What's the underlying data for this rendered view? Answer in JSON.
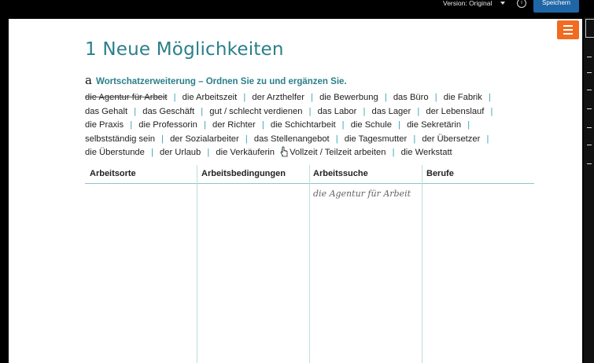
{
  "topbar": {
    "version_label": "Version: Original",
    "info_icon": "info-icon",
    "save_label": "Speichern"
  },
  "toc_icon": "list-icon",
  "exercise": {
    "number": "1",
    "title": "Neue Möglichkeiten",
    "part_letter": "a",
    "instruction": "Wortschatzerweiterung – Ordnen Sie zu und ergänzen Sie.",
    "words": [
      {
        "text": "die Agentur für Arbeit",
        "struck": true
      },
      {
        "text": "die Arbeitszeit"
      },
      {
        "text": "der Arzthelfer"
      },
      {
        "text": "die Bewerbung"
      },
      {
        "text": "das Büro"
      },
      {
        "text": "die Fabrik"
      },
      {
        "text": "das Gehalt"
      },
      {
        "text": "das Geschäft"
      },
      {
        "text": "gut / schlecht verdienen"
      },
      {
        "text": "das Labor"
      },
      {
        "text": "das Lager"
      },
      {
        "text": "der Lebenslauf"
      },
      {
        "text": "die Praxis"
      },
      {
        "text": "die Professorin"
      },
      {
        "text": "der Richter"
      },
      {
        "text": "die Schichtarbeit"
      },
      {
        "text": "die Schule"
      },
      {
        "text": "die Sekretärin"
      },
      {
        "text": "selbstständig sein"
      },
      {
        "text": "der Sozialarbeiter"
      },
      {
        "text": "das Stellenangebot"
      },
      {
        "text": "die Tagesmutter"
      },
      {
        "text": "der Übersetzer"
      },
      {
        "text": "die Überstunde"
      },
      {
        "text": "der Urlaub"
      },
      {
        "text": "die Verkäuferin"
      },
      {
        "text": "Vollzeit / Teilzeit arbeiten"
      },
      {
        "text": "die Werkstatt"
      }
    ],
    "table": {
      "headers": [
        "Arbeitsorte",
        "Arbeitsbedingungen",
        "Arbeitssuche",
        "Berufe"
      ],
      "example_entry": "die Agentur für Arbeit"
    }
  }
}
